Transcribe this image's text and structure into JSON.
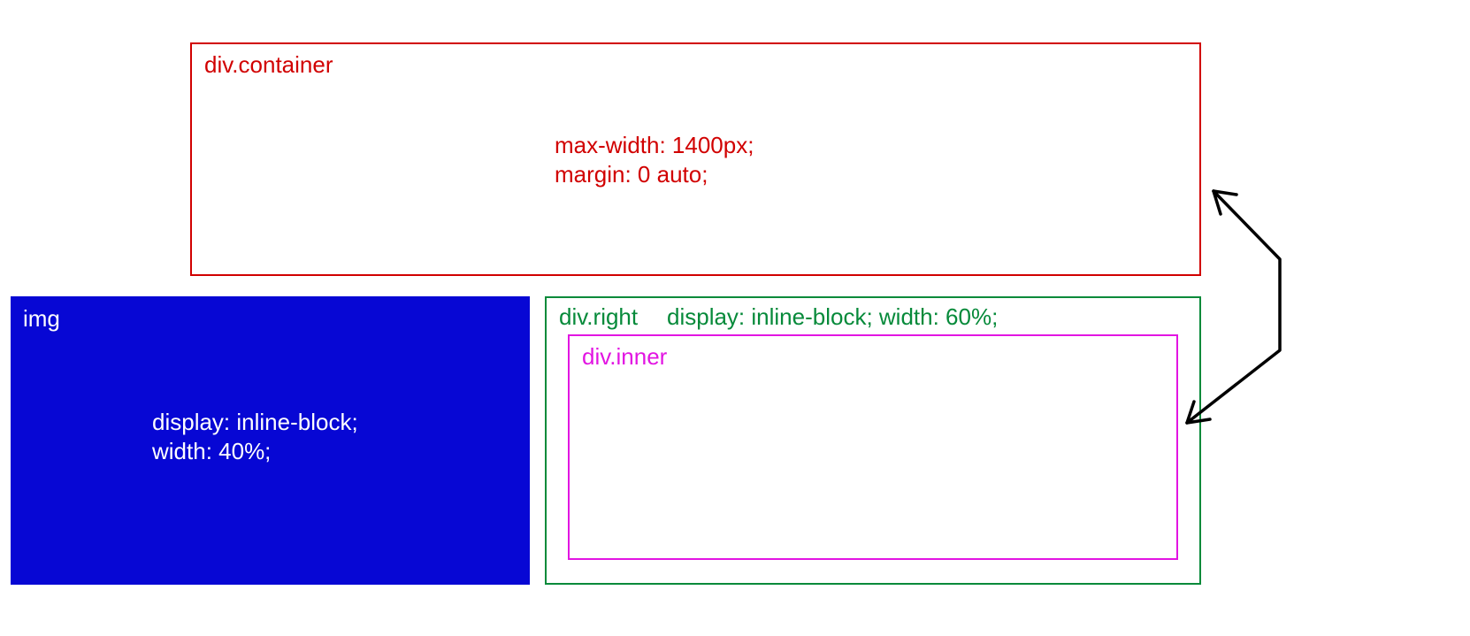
{
  "container": {
    "label": "div.container",
    "rule1": "max-width: 1400px;",
    "rule2": "margin: 0 auto;"
  },
  "img": {
    "label": "img",
    "rule1": "display: inline-block;",
    "rule2": "width: 40%;"
  },
  "right": {
    "label": "div.right",
    "rules": "display: inline-block; width: 60%;"
  },
  "inner": {
    "label": "div.inner"
  }
}
